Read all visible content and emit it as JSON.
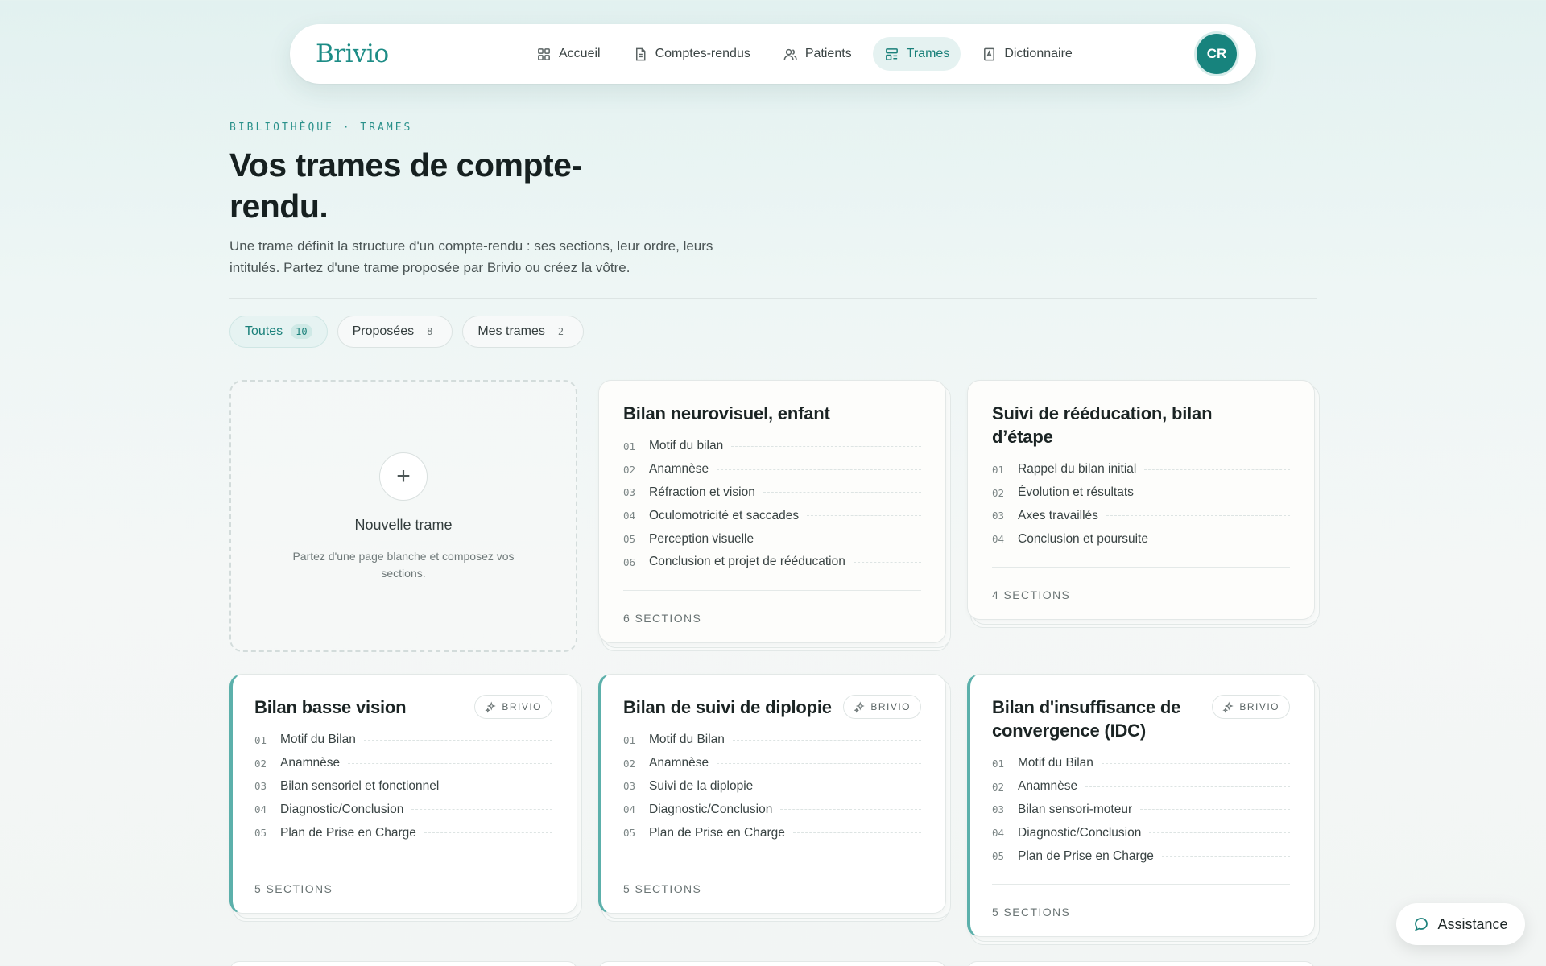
{
  "nav": {
    "logo": "Brivio",
    "items": [
      {
        "label": "Accueil",
        "icon": "grid-icon"
      },
      {
        "label": "Comptes-rendus",
        "icon": "document-icon"
      },
      {
        "label": "Patients",
        "icon": "users-icon"
      },
      {
        "label": "Trames",
        "icon": "template-icon"
      },
      {
        "label": "Dictionnaire",
        "icon": "book-icon"
      }
    ],
    "active": "Trames",
    "avatar": "CR"
  },
  "header": {
    "eyebrow": "BIBLIOTHÈQUE · TRAMES",
    "title": "Vos trames de compte-rendu.",
    "description": "Une trame définit la structure d'un compte-rendu : ses sections, leur ordre, leurs intitulés. Partez d'une trame proposée par Brivio ou créez la vôtre."
  },
  "filters": [
    {
      "label": "Toutes",
      "count": "10",
      "active": true
    },
    {
      "label": "Proposées",
      "count": "8",
      "active": false
    },
    {
      "label": "Mes trames",
      "count": "2",
      "active": false
    }
  ],
  "new_template": {
    "title": "Nouvelle trame",
    "description": "Partez d'une page blanche et composez vos sections."
  },
  "cards": [
    {
      "title": "Bilan neurovisuel, enfant",
      "badge": "",
      "sections": [
        "Motif du bilan",
        "Anamnèse",
        "Réfraction et vision",
        "Oculomotricité et saccades",
        "Perception visuelle",
        "Conclusion et projet de rééducation"
      ],
      "footer": "6 SECTIONS"
    },
    {
      "title": "Suivi de rééducation, bilan d’étape",
      "badge": "",
      "sections": [
        "Rappel du bilan initial",
        "Évolution et résultats",
        "Axes travaillés",
        "Conclusion et poursuite"
      ],
      "footer": "4 SECTIONS"
    },
    {
      "title": "Bilan basse vision",
      "badge": "BRIVIO",
      "sections": [
        "Motif du Bilan",
        "Anamnèse",
        "Bilan sensoriel et fonctionnel",
        "Diagnostic/Conclusion",
        "Plan de Prise en Charge"
      ],
      "footer": "5 SECTIONS"
    },
    {
      "title": "Bilan de suivi de diplopie",
      "badge": "BRIVIO",
      "sections": [
        "Motif du Bilan",
        "Anamnèse",
        "Suivi de la diplopie",
        "Diagnostic/Conclusion",
        "Plan de Prise en Charge"
      ],
      "footer": "5 SECTIONS"
    },
    {
      "title": "Bilan d'insuffisance de convergence (IDC)",
      "badge": "BRIVIO",
      "sections": [
        "Motif du Bilan",
        "Anamnèse",
        "Bilan sensori-moteur",
        "Diagnostic/Conclusion",
        "Plan de Prise en Charge"
      ],
      "footer": "5 SECTIONS"
    }
  ],
  "assistance": {
    "label": "Assistance"
  },
  "colors": {
    "brand": "#1d8c86",
    "accent_border": "#5cb0ab",
    "avatar_bg": "#17837d"
  }
}
